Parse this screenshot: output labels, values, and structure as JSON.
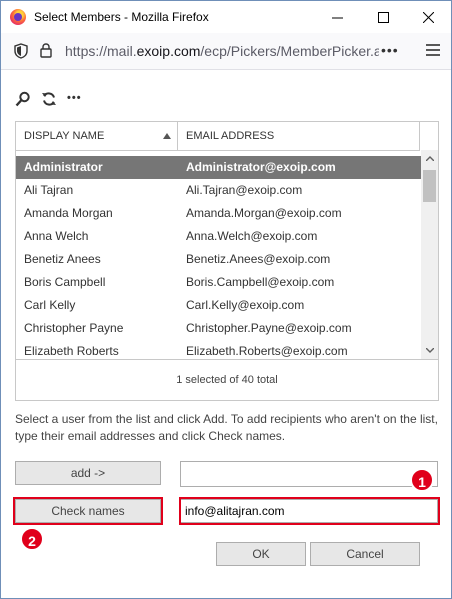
{
  "window": {
    "title": "Select Members - Mozilla Firefox"
  },
  "address_bar": {
    "url_prefix": "https://mail.",
    "url_domain": "exoip.com",
    "url_path": "/ecp/Pickers/MemberPicker.a",
    "overflow": "•••"
  },
  "toolbar": {
    "more_label": "•••"
  },
  "grid": {
    "columns": [
      "DISPLAY NAME",
      "EMAIL ADDRESS"
    ],
    "sort_column": "DISPLAY NAME",
    "rows": [
      {
        "name": "Administrator",
        "email": "Administrator@exoip.com",
        "selected": true
      },
      {
        "name": "Ali Tajran",
        "email": "Ali.Tajran@exoip.com"
      },
      {
        "name": "Amanda Morgan",
        "email": "Amanda.Morgan@exoip.com"
      },
      {
        "name": "Anna Welch",
        "email": "Anna.Welch@exoip.com"
      },
      {
        "name": "Benetiz Anees",
        "email": "Benetiz.Anees@exoip.com"
      },
      {
        "name": "Boris Campbell",
        "email": "Boris.Campbell@exoip.com"
      },
      {
        "name": "Carl Kelly",
        "email": "Carl.Kelly@exoip.com"
      },
      {
        "name": "Christopher Payne",
        "email": "Christopher.Payne@exoip.com"
      },
      {
        "name": "Elizabeth Roberts",
        "email": "Elizabeth.Roberts@exoip.com"
      }
    ],
    "status": "1 selected of 40 total"
  },
  "instructions": "Select a user from the list and click Add. To add recipients who aren't on the list, type their email addresses and click Check names.",
  "form": {
    "add_label": "add ->",
    "add_value": "",
    "check_names_label": "Check names",
    "check_value": "info@alitajran.com"
  },
  "actions": {
    "ok_label": "OK",
    "cancel_label": "Cancel"
  },
  "annotations": {
    "badge1": "1",
    "badge2": "2",
    "color": "#e0001b"
  }
}
